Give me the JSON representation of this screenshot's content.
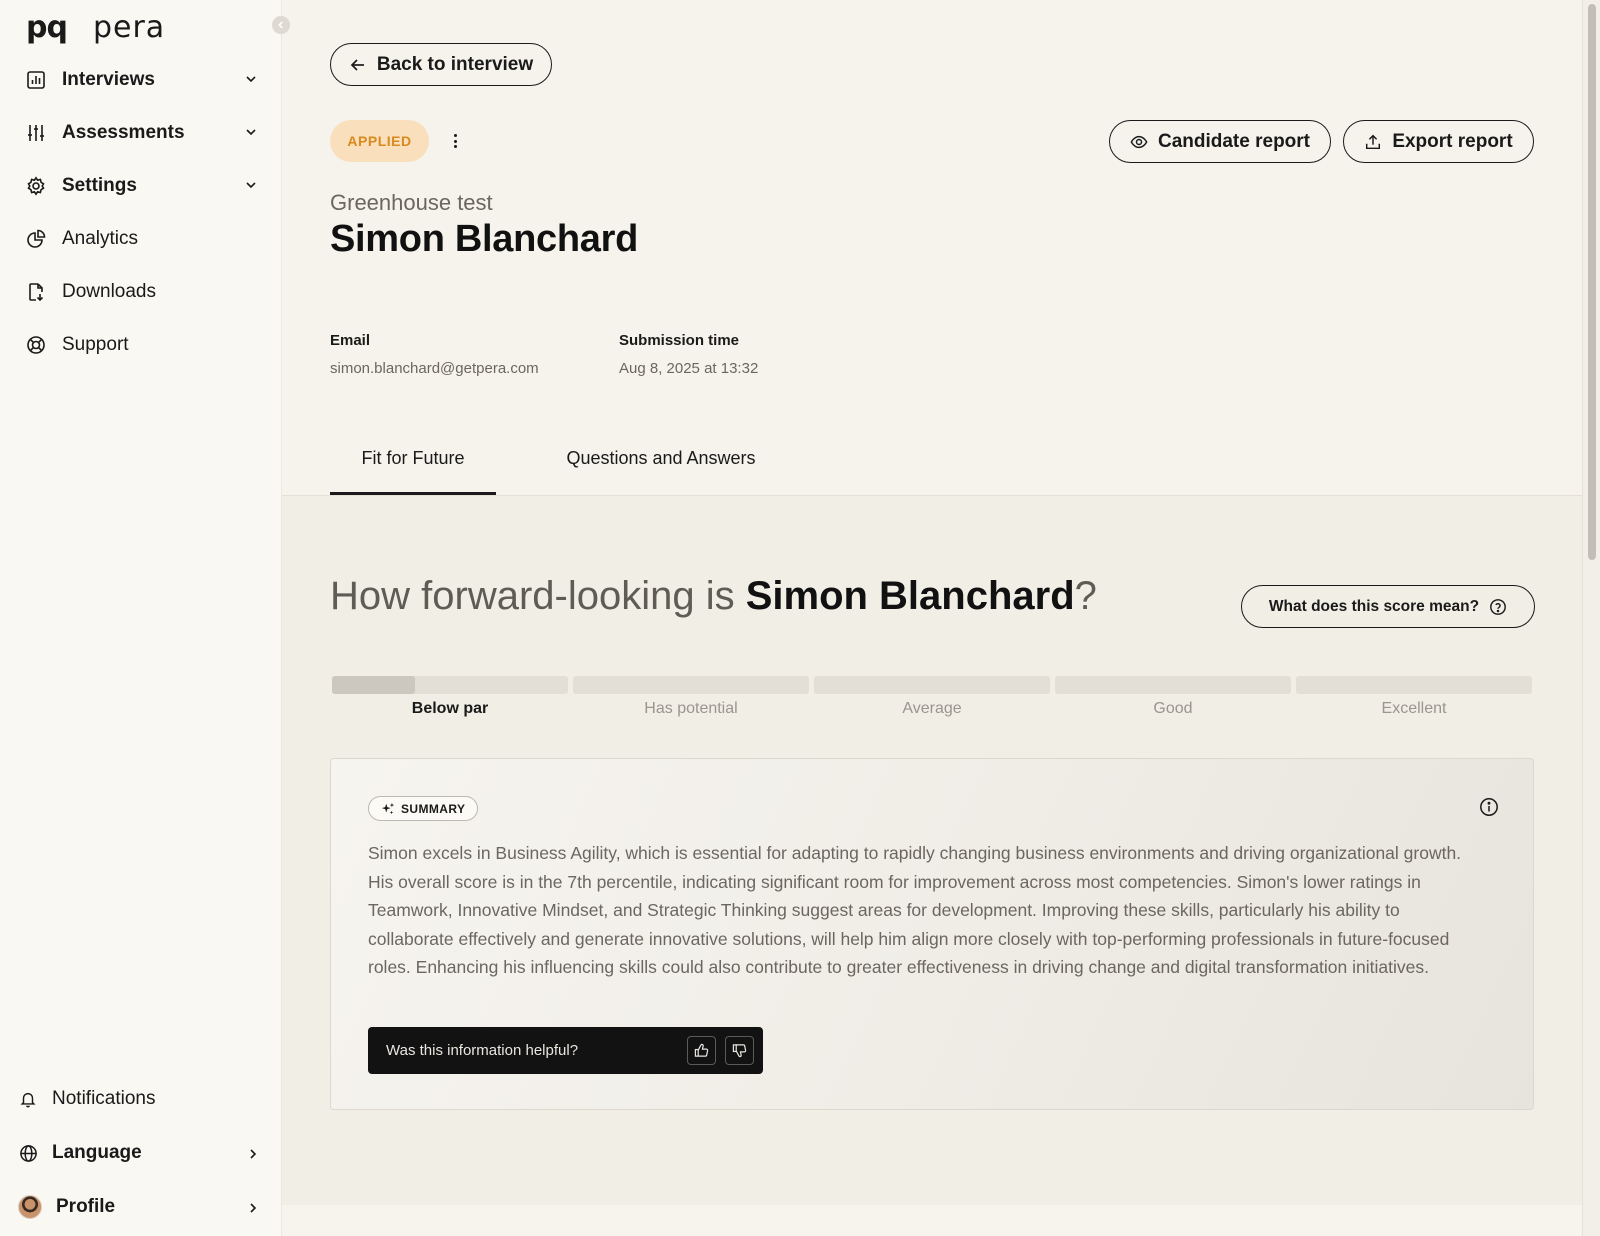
{
  "brand": {
    "mark": "pq",
    "word": "pera"
  },
  "sidebar": {
    "items": [
      {
        "label": "Interviews",
        "icon": "bar-chart-icon",
        "expandable": true
      },
      {
        "label": "Assessments",
        "icon": "sliders-icon",
        "expandable": true
      },
      {
        "label": "Settings",
        "icon": "gear-icon",
        "expandable": true
      },
      {
        "label": "Analytics",
        "icon": "pie-chart-icon",
        "expandable": false
      },
      {
        "label": "Downloads",
        "icon": "file-download-icon",
        "expandable": false
      },
      {
        "label": "Support",
        "icon": "lifebuoy-icon",
        "expandable": false
      }
    ],
    "bottom": [
      {
        "label": "Notifications",
        "icon": "bell-icon"
      },
      {
        "label": "Language",
        "icon": "globe-icon"
      },
      {
        "label": "Profile",
        "icon": "avatar"
      }
    ]
  },
  "header": {
    "back_label": "Back to interview",
    "status_badge": "APPLIED",
    "candidate_report_label": "Candidate report",
    "export_report_label": "Export report",
    "subtitle": "Greenhouse test",
    "candidate_name": "Simon Blanchard"
  },
  "meta": {
    "email_label": "Email",
    "email_value": "simon.blanchard@getpera.com",
    "submission_label": "Submission time",
    "submission_value": "Aug 8, 2025 at 13:32"
  },
  "tabs": [
    {
      "label": "Fit for Future",
      "active": true
    },
    {
      "label": "Questions and Answers",
      "active": false
    }
  ],
  "score": {
    "question_prefix": "How forward-looking is ",
    "question_name": "Simon Blanchard",
    "question_suffix": "?",
    "help_label": "What does this score mean?",
    "levels": [
      "Below par",
      "Has potential",
      "Average",
      "Good",
      "Excellent"
    ],
    "current_level": "Below par",
    "current_level_fill": 0.35
  },
  "summary": {
    "chip_label": "SUMMARY",
    "text": "Simon excels in Business Agility, which is essential for adapting to rapidly changing business environments and driving organizational growth. His overall score is in the 7th percentile, indicating significant room for improvement across most competencies. Simon's lower ratings in Teamwork, Innovative Mindset, and Strategic Thinking suggest areas for development. Improving these skills, particularly his ability to collaborate effectively and generate innovative solutions, will help him align more closely with top-performing professionals in future-focused roles. Enhancing his influencing skills could also contribute to greater effectiveness in driving change and digital transformation initiatives.",
    "feedback_prompt": "Was this information helpful?"
  },
  "colors": {
    "page_bg": "#f6f3ec",
    "sidebar_bg": "#faf8f3",
    "badge_bg": "#f9dfbb",
    "badge_text": "#d98a1f",
    "feedback_bg": "#121212"
  }
}
